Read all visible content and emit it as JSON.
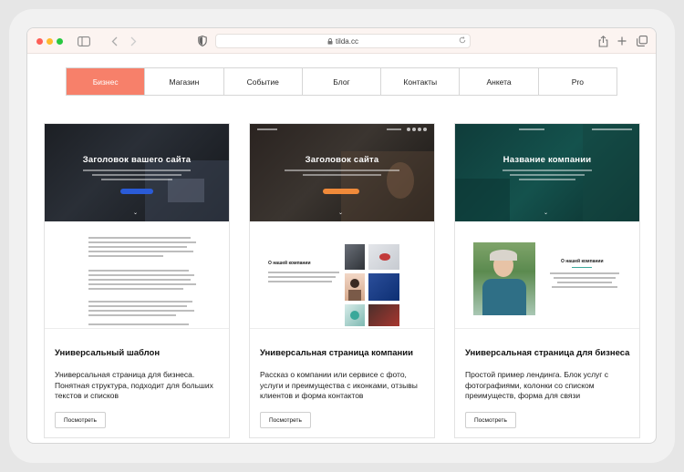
{
  "browser": {
    "url": "tilda.cc"
  },
  "categories": [
    {
      "label": "Бизнес",
      "active": true
    },
    {
      "label": "Магазин",
      "active": false
    },
    {
      "label": "Событие",
      "active": false
    },
    {
      "label": "Блог",
      "active": false
    },
    {
      "label": "Контакты",
      "active": false
    },
    {
      "label": "Анкета",
      "active": false
    },
    {
      "label": "Pro",
      "active": false
    }
  ],
  "templates": [
    {
      "preview_title": "Заголовок вашего сайта",
      "title": "Универсальный шаблон",
      "description": "Универсальная страница для бизнеса. Понятная структура, подходит для больших текстов и списков",
      "button": "Посмотреть"
    },
    {
      "preview_title": "Заголовок сайта",
      "preview_section": "О нашей компании",
      "title": "Универсальная страница компании",
      "description": "Рассказ о компании или сервисе с фото, услуги и преимущества с иконками, отзывы клиентов и форма контактов",
      "button": "Посмотреть"
    },
    {
      "preview_title": "Название компании",
      "preview_section": "О нашей компании",
      "title": "Универсальная страница для бизнеса",
      "description": "Простой пример лендинга. Блок услуг с фотографиями, колонки со списком преимуществ, форма для связи",
      "button": "Посмотреть"
    }
  ],
  "colors": {
    "accent": "#f7806a",
    "hero_button_blue": "#2a5bd7",
    "hero_button_orange": "#f08a3a"
  }
}
